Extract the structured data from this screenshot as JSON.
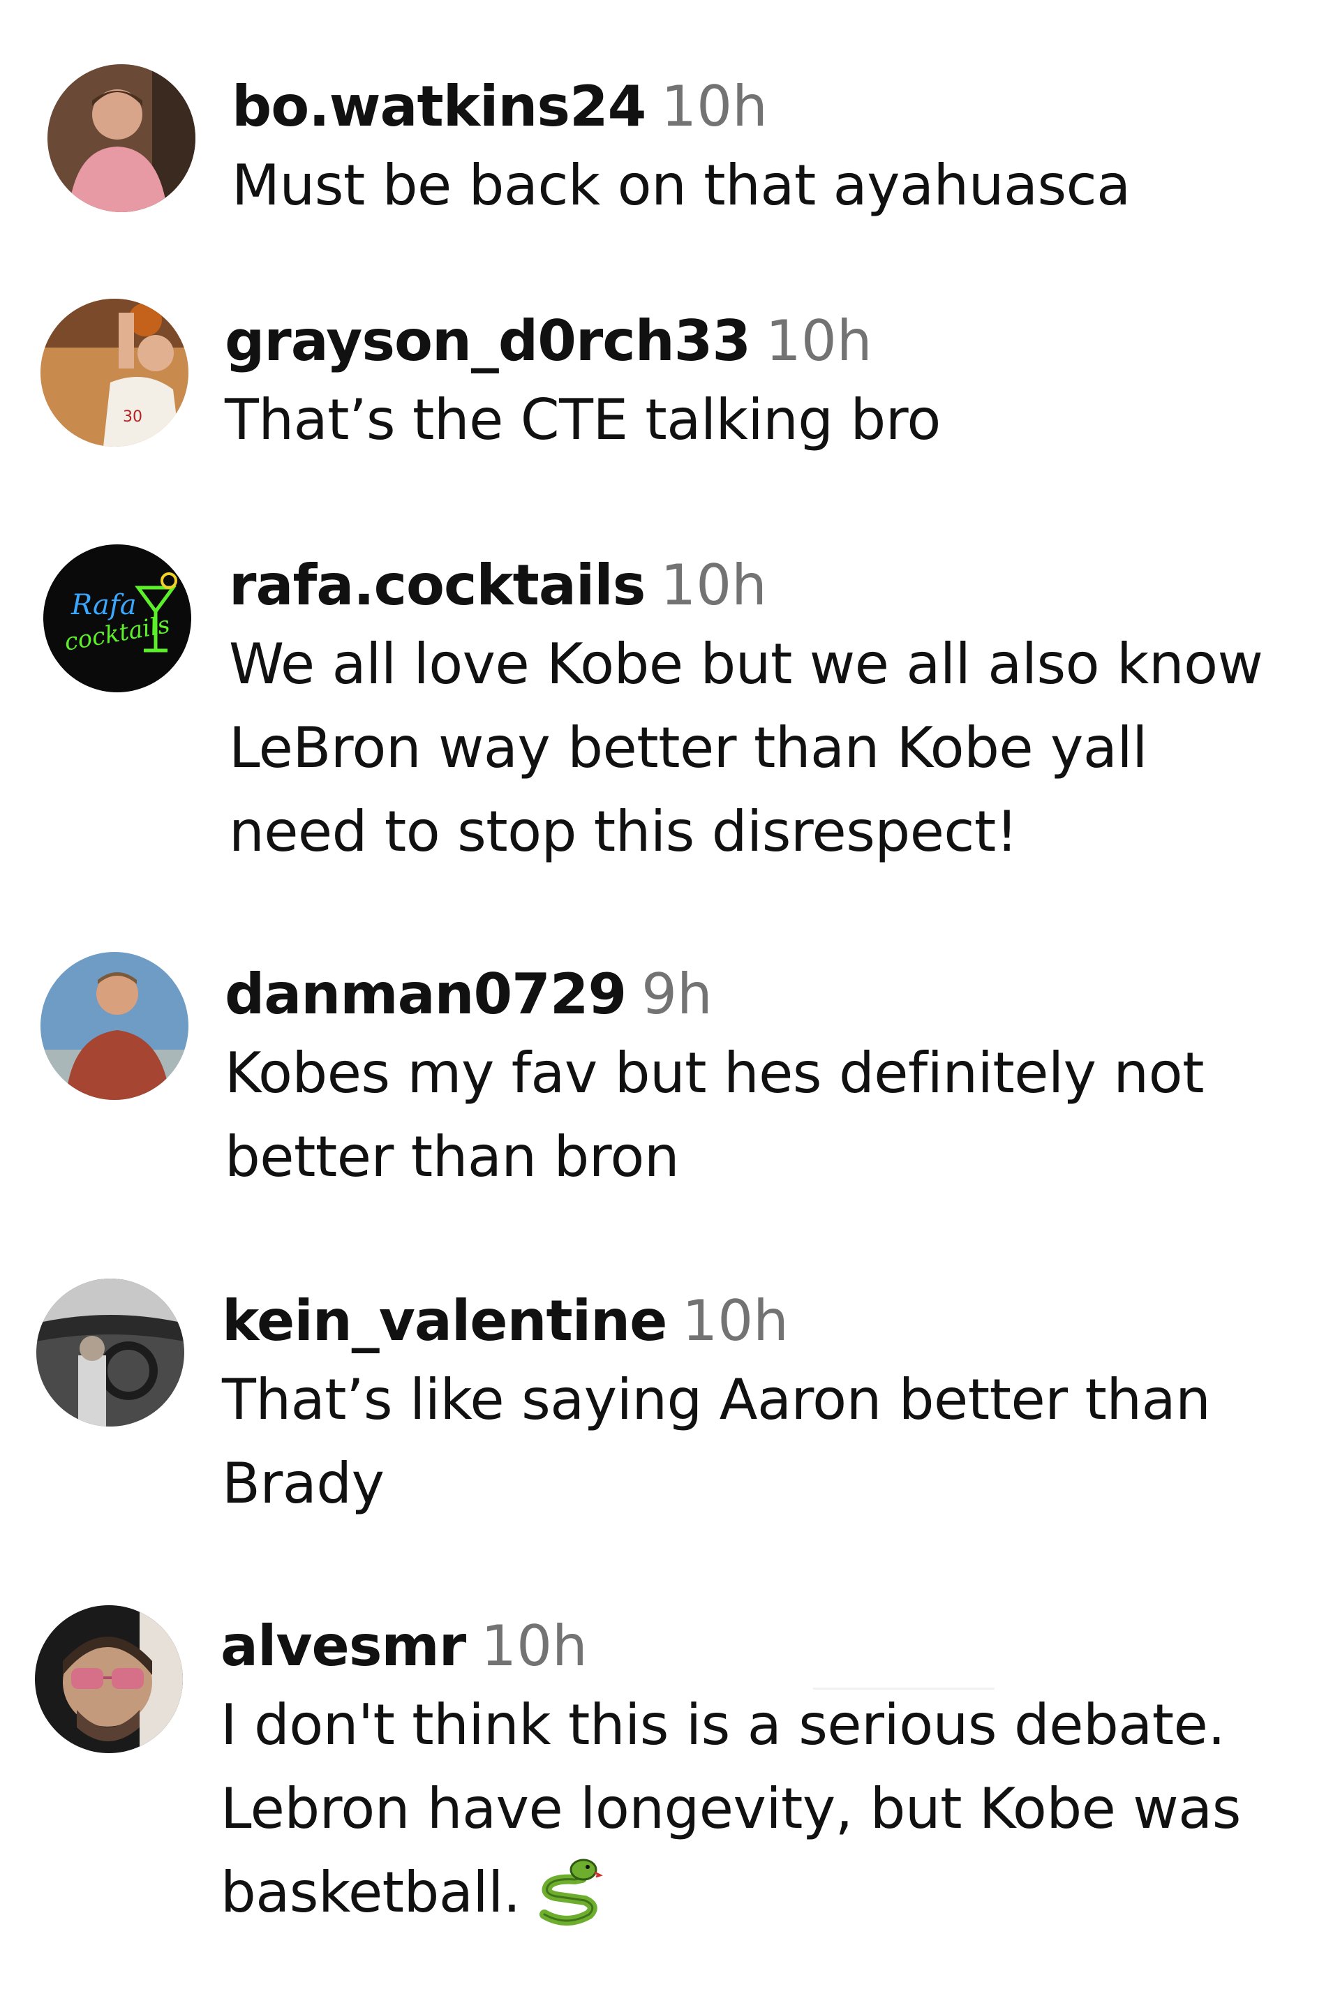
{
  "comments": [
    {
      "username": "bo.watkins24",
      "time": "10h",
      "lines": [
        "Must be back on that ayahuasca"
      ],
      "avatar_icon": "person-pink-shirt-avatar-icon"
    },
    {
      "username": "grayson_d0rch33",
      "time": "10h",
      "lines": [
        "That’s the CTE talking bro"
      ],
      "avatar_icon": "basketball-player-avatar-icon"
    },
    {
      "username": "rafa.cocktails",
      "time": "10h",
      "lines": [
        "We all love Kobe but we all also know",
        "LeBron way better than Kobe yall",
        "need to stop this disrespect!"
      ],
      "avatar_icon": "neon-cocktail-logo-avatar-icon",
      "avatar_logo": {
        "line1": "Rafa",
        "line2": "cocktails"
      }
    },
    {
      "username": "danman0729",
      "time": "9h",
      "lines": [
        "Kobes my fav but hes definitely not",
        "better than bron"
      ],
      "avatar_icon": "person-sky-avatar-icon"
    },
    {
      "username": "kein_valentine",
      "time": "10h",
      "lines": [
        "That’s like saying Aaron better than",
        "Brady"
      ],
      "avatar_icon": "car-interior-avatar-icon"
    },
    {
      "username": "alvesmr",
      "time": "10h",
      "lines": [
        "I don't think this is a serious debate.",
        "Lebron have longevity, but Kobe was",
        "basketball."
      ],
      "avatar_icon": "person-sunglasses-avatar-icon",
      "trailing_icon": "snake-emoji-icon"
    }
  ],
  "colors": {
    "username": "#111111",
    "timestamp": "#737373",
    "neon_green": "#5cf02a",
    "neon_blue": "#3aa8ff"
  }
}
